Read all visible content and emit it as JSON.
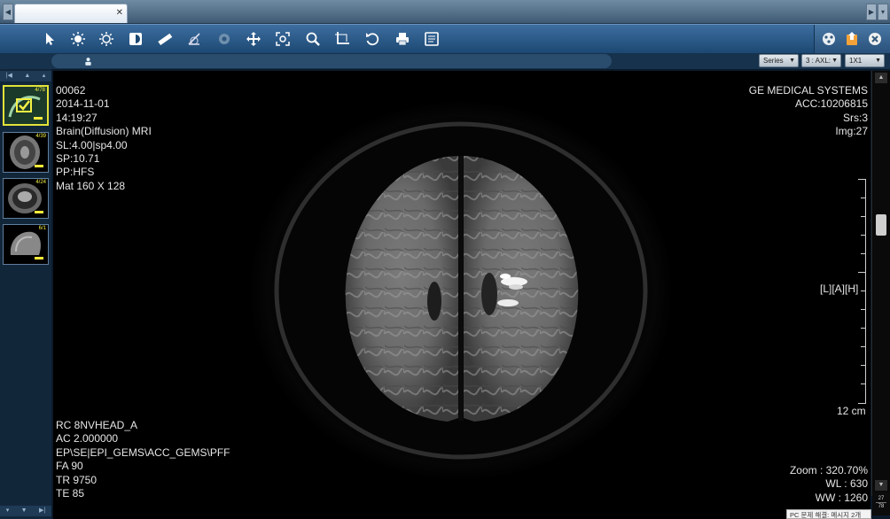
{
  "thumbnails": [
    {
      "count": "4/78"
    },
    {
      "count": "4/39"
    },
    {
      "count": "4/24"
    },
    {
      "count": "6/1"
    }
  ],
  "subtoolbar": {
    "series_dropdown": "Series",
    "axial_dropdown": "3 : AXL:",
    "layout_dropdown": "1X1"
  },
  "overlay": {
    "top_left": [
      "00062",
      "2014-11-01",
      "14:19:27",
      "Brain(Diffusion) MRI",
      "SL:4.00|sp4.00",
      "SP:10.71",
      "PP:HFS",
      "Mat 160 X 128"
    ],
    "top_right": [
      "GE MEDICAL SYSTEMS",
      "ACC:10206815",
      "Srs:3",
      "Img:27"
    ],
    "orientation": "[L][A][H]",
    "scale_label": "12 cm",
    "bottom_left": [
      "RC 8NVHEAD_A",
      "AC 2.000000",
      "EP\\SE|EPI_GEMS\\ACC_GEMS\\PFF",
      "FA 90",
      "TR 9750",
      "TE 85"
    ],
    "bottom_right": [
      "Zoom : 320.70%",
      "WL : 630",
      "WW : 1260"
    ]
  },
  "image_counter": {
    "current": "27",
    "total": "78"
  },
  "status_tooltip": "PC 문제 해결: 메시지 2개",
  "colors": {
    "toolbar": "#2a5a8a",
    "viewport": "#000000",
    "overlay_text": "#e6e6e6",
    "highlight": "#e2e23a"
  }
}
